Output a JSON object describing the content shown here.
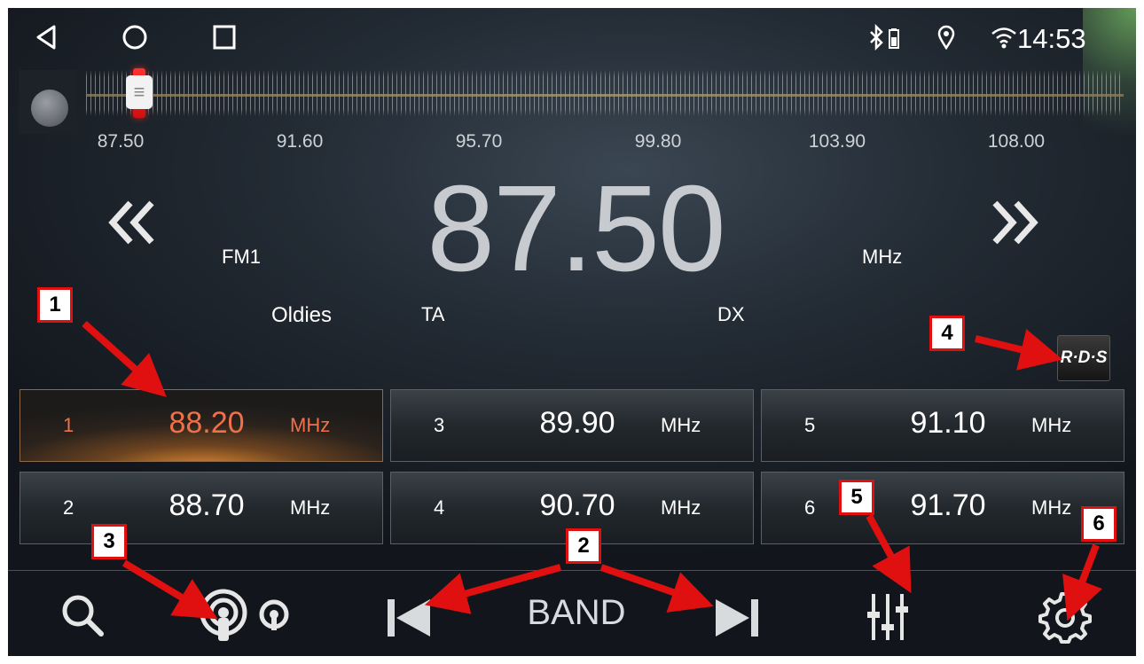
{
  "status_bar": {
    "time": "14:53",
    "icons": [
      "bluetooth-icon",
      "battery-icon",
      "location-icon",
      "wifi-icon"
    ]
  },
  "nav": {
    "icons": [
      "back-icon",
      "home-icon",
      "recents-icon"
    ]
  },
  "scale": {
    "labels": [
      "87.50",
      "91.60",
      "95.70",
      "99.80",
      "103.90",
      "108.00"
    ],
    "current_position": 0.0
  },
  "tuner": {
    "frequency": "87.50",
    "band_label": "FM1",
    "unit": "MHz",
    "program_type": "Oldies",
    "ta": "TA",
    "dx": "DX",
    "rds_label": "R·D·S"
  },
  "presets": [
    {
      "num": "1",
      "freq": "88.20",
      "unit": "MHz",
      "active": true
    },
    {
      "num": "3",
      "freq": "89.90",
      "unit": "MHz",
      "active": false
    },
    {
      "num": "5",
      "freq": "91.10",
      "unit": "MHz",
      "active": false
    },
    {
      "num": "2",
      "freq": "88.70",
      "unit": "MHz",
      "active": false
    },
    {
      "num": "4",
      "freq": "90.70",
      "unit": "MHz",
      "active": false
    },
    {
      "num": "6",
      "freq": "91.70",
      "unit": "MHz",
      "active": false
    }
  ],
  "toolbar": {
    "band_label": "BAND",
    "icons": [
      "search-icon",
      "stereo-icon",
      "prev-icon",
      "next-icon",
      "equalizer-icon",
      "settings-icon"
    ]
  },
  "annotations": {
    "badge_1": "1",
    "badge_2": "2",
    "badge_3": "3",
    "badge_4": "4",
    "badge_5": "5",
    "badge_6": "6"
  },
  "colors": {
    "annotation_red": "#e01010",
    "active_preset": "#f0704a",
    "needle": "#ff3030"
  }
}
